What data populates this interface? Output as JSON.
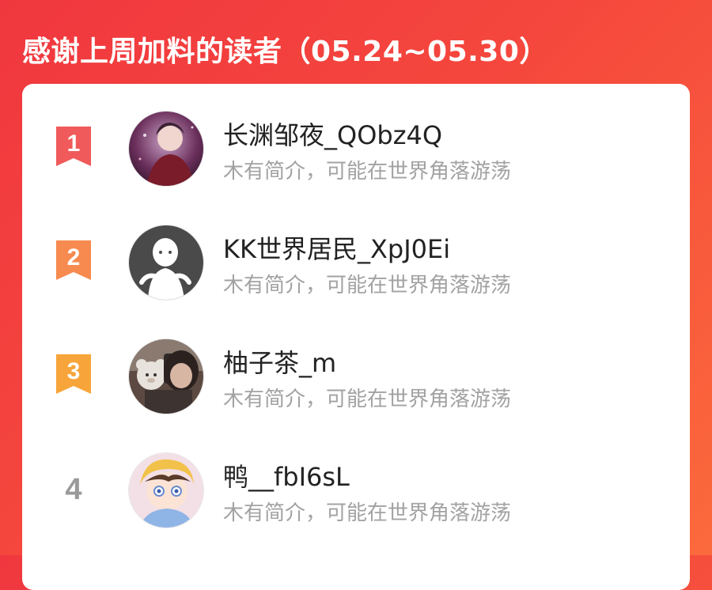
{
  "header": {
    "title": "感谢上周加料的读者（05.24~05.30）"
  },
  "readers": [
    {
      "rank": "1",
      "name": "长渊邹夜_QObz4Q",
      "bio": "木有简介，可能在世界角落游荡",
      "badge_color": "#f05a5a"
    },
    {
      "rank": "2",
      "name": "KK世界居民_XpJ0Ei",
      "bio": "木有简介，可能在世界角落游荡",
      "badge_color": "#f78a4f"
    },
    {
      "rank": "3",
      "name": "柚子茶_m",
      "bio": "木有简介，可能在世界角落游荡",
      "badge_color": "#f7a53a"
    },
    {
      "rank": "4",
      "name": "鸭__fbI6sL",
      "bio": "木有简介，可能在世界角落游荡",
      "badge_color": ""
    }
  ],
  "colors": {
    "background_start": "#f0373f",
    "background_end": "#fb6a3c",
    "name_text": "#222222",
    "bio_text": "#a2a2a2",
    "rank_plain": "#9a9a9a"
  }
}
